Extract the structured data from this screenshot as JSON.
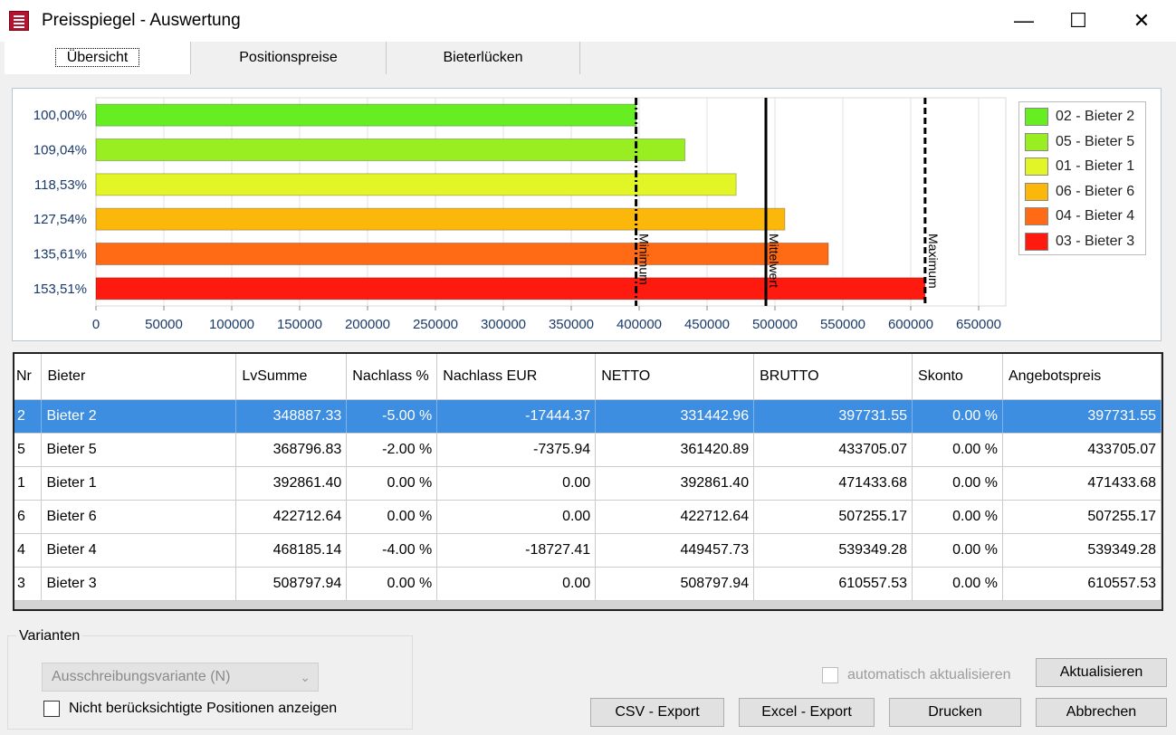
{
  "window": {
    "title": "Preisspiegel - Auswertung",
    "minimize": "—",
    "maximize": "☐",
    "close": "✕"
  },
  "tabs": [
    {
      "label": "Übersicht",
      "active": true
    },
    {
      "label": "Positionspreise"
    },
    {
      "label": "Bieterlücken"
    }
  ],
  "chart_data": {
    "type": "bar",
    "orientation": "horizontal",
    "categories": [
      "100,00%",
      "109,04%",
      "118,53%",
      "127,54%",
      "135,61%",
      "153,51%"
    ],
    "values": [
      397731.55,
      433705.07,
      471433.68,
      507255.17,
      539349.28,
      610557.53
    ],
    "colors": [
      "#66ee22",
      "#99ee22",
      "#e2f527",
      "#fbb80b",
      "#ff6a14",
      "#ff1a10"
    ],
    "xlim": [
      0,
      670000
    ],
    "x_ticks": [
      0,
      50000,
      100000,
      150000,
      200000,
      250000,
      300000,
      350000,
      400000,
      450000,
      500000,
      550000,
      600000,
      650000
    ],
    "grid": true,
    "reference_lines": [
      {
        "label": "Minimum",
        "value": 397731.55,
        "style": "dashdot"
      },
      {
        "label": "Mittelwert",
        "value": 493338.71,
        "style": "solid"
      },
      {
        "label": "Maximum",
        "value": 610557.53,
        "style": "dashed"
      }
    ],
    "legend": {
      "placement": "right",
      "entries": [
        {
          "label": "02 - Bieter 2",
          "color": "#66ee22"
        },
        {
          "label": "05 - Bieter 5",
          "color": "#99ee22"
        },
        {
          "label": "01 - Bieter 1",
          "color": "#e2f527"
        },
        {
          "label": "06 - Bieter 6",
          "color": "#fbb80b"
        },
        {
          "label": "04 - Bieter 4",
          "color": "#ff6a14"
        },
        {
          "label": "03 - Bieter 3",
          "color": "#ff1a10"
        }
      ]
    }
  },
  "table": {
    "columns": [
      "Nr",
      "Bieter",
      "LvSumme",
      "Nachlass %",
      "Nachlass EUR",
      "NETTO",
      "BRUTTO",
      "Skonto",
      "Angebotspreis"
    ],
    "rows": [
      [
        "2",
        "Bieter 2",
        "348887.33",
        "-5.00 %",
        "-17444.37",
        "331442.96",
        "397731.55",
        "0.00 %",
        "397731.55"
      ],
      [
        "5",
        "Bieter 5",
        "368796.83",
        "-2.00 %",
        "-7375.94",
        "361420.89",
        "433705.07",
        "0.00 %",
        "433705.07"
      ],
      [
        "1",
        "Bieter 1",
        "392861.40",
        "0.00 %",
        "0.00",
        "392861.40",
        "471433.68",
        "0.00 %",
        "471433.68"
      ],
      [
        "6",
        "Bieter 6",
        "422712.64",
        "0.00 %",
        "0.00",
        "422712.64",
        "507255.17",
        "0.00 %",
        "507255.17"
      ],
      [
        "4",
        "Bieter 4",
        "468185.14",
        "-4.00 %",
        "-18727.41",
        "449457.73",
        "539349.28",
        "0.00 %",
        "539349.28"
      ],
      [
        "3",
        "Bieter 3",
        "508797.94",
        "0.00 %",
        "0.00",
        "508797.94",
        "610557.53",
        "0.00 %",
        "610557.53"
      ]
    ],
    "selected_row": 0
  },
  "variants": {
    "group_title": "Varianten",
    "combo_value": "Ausschreibungsvariante (N)",
    "show_unconsidered_label": "Nicht berücksichtigte Positionen anzeigen",
    "show_unconsidered_checked": false
  },
  "auto_update": {
    "label": "automatisch aktualisieren",
    "checked": false,
    "enabled": false
  },
  "buttons": {
    "refresh": "Aktualisieren",
    "csv_export": "CSV - Export",
    "excel_export": "Excel - Export",
    "print": "Drucken",
    "cancel": "Abbrechen"
  }
}
